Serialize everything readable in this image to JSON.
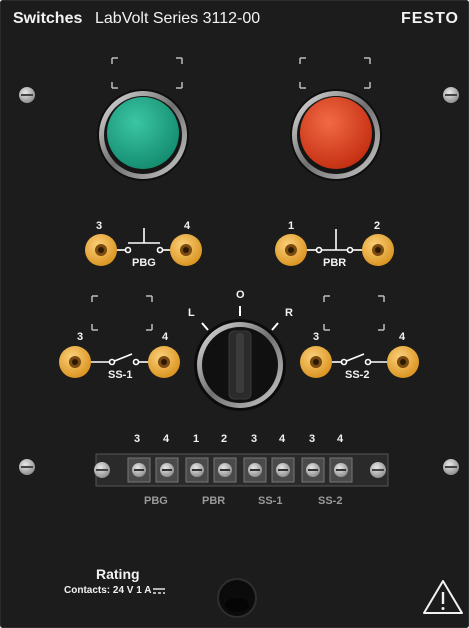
{
  "header": {
    "title": "Switches",
    "series": "LabVolt Series 3112-00",
    "brand": "FESTO"
  },
  "pushbuttons": {
    "pbg": {
      "label": "PBG",
      "terminal_left": "3",
      "terminal_right": "4",
      "color": "#1fa889"
    },
    "pbr": {
      "label": "PBR",
      "terminal_left": "1",
      "terminal_right": "2",
      "color": "#e8411f"
    }
  },
  "selector": {
    "pos_left": "L",
    "pos_center": "O",
    "pos_right": "R"
  },
  "selector_switches": {
    "ss1": {
      "label": "SS-1",
      "terminal_left": "3",
      "terminal_right": "4"
    },
    "ss2": {
      "label": "SS-2",
      "terminal_left": "3",
      "terminal_right": "4"
    }
  },
  "terminal_block": {
    "numbers": [
      "3",
      "4",
      "1",
      "2",
      "3",
      "4",
      "3",
      "4"
    ],
    "group_labels": [
      "PBG",
      "PBR",
      "SS-1",
      "SS-2"
    ]
  },
  "rating": {
    "title": "Rating",
    "contacts": "Contacts: 24 V  1 A"
  },
  "colors": {
    "panel": "#1c1c1c",
    "jack": "#f3b23c"
  }
}
